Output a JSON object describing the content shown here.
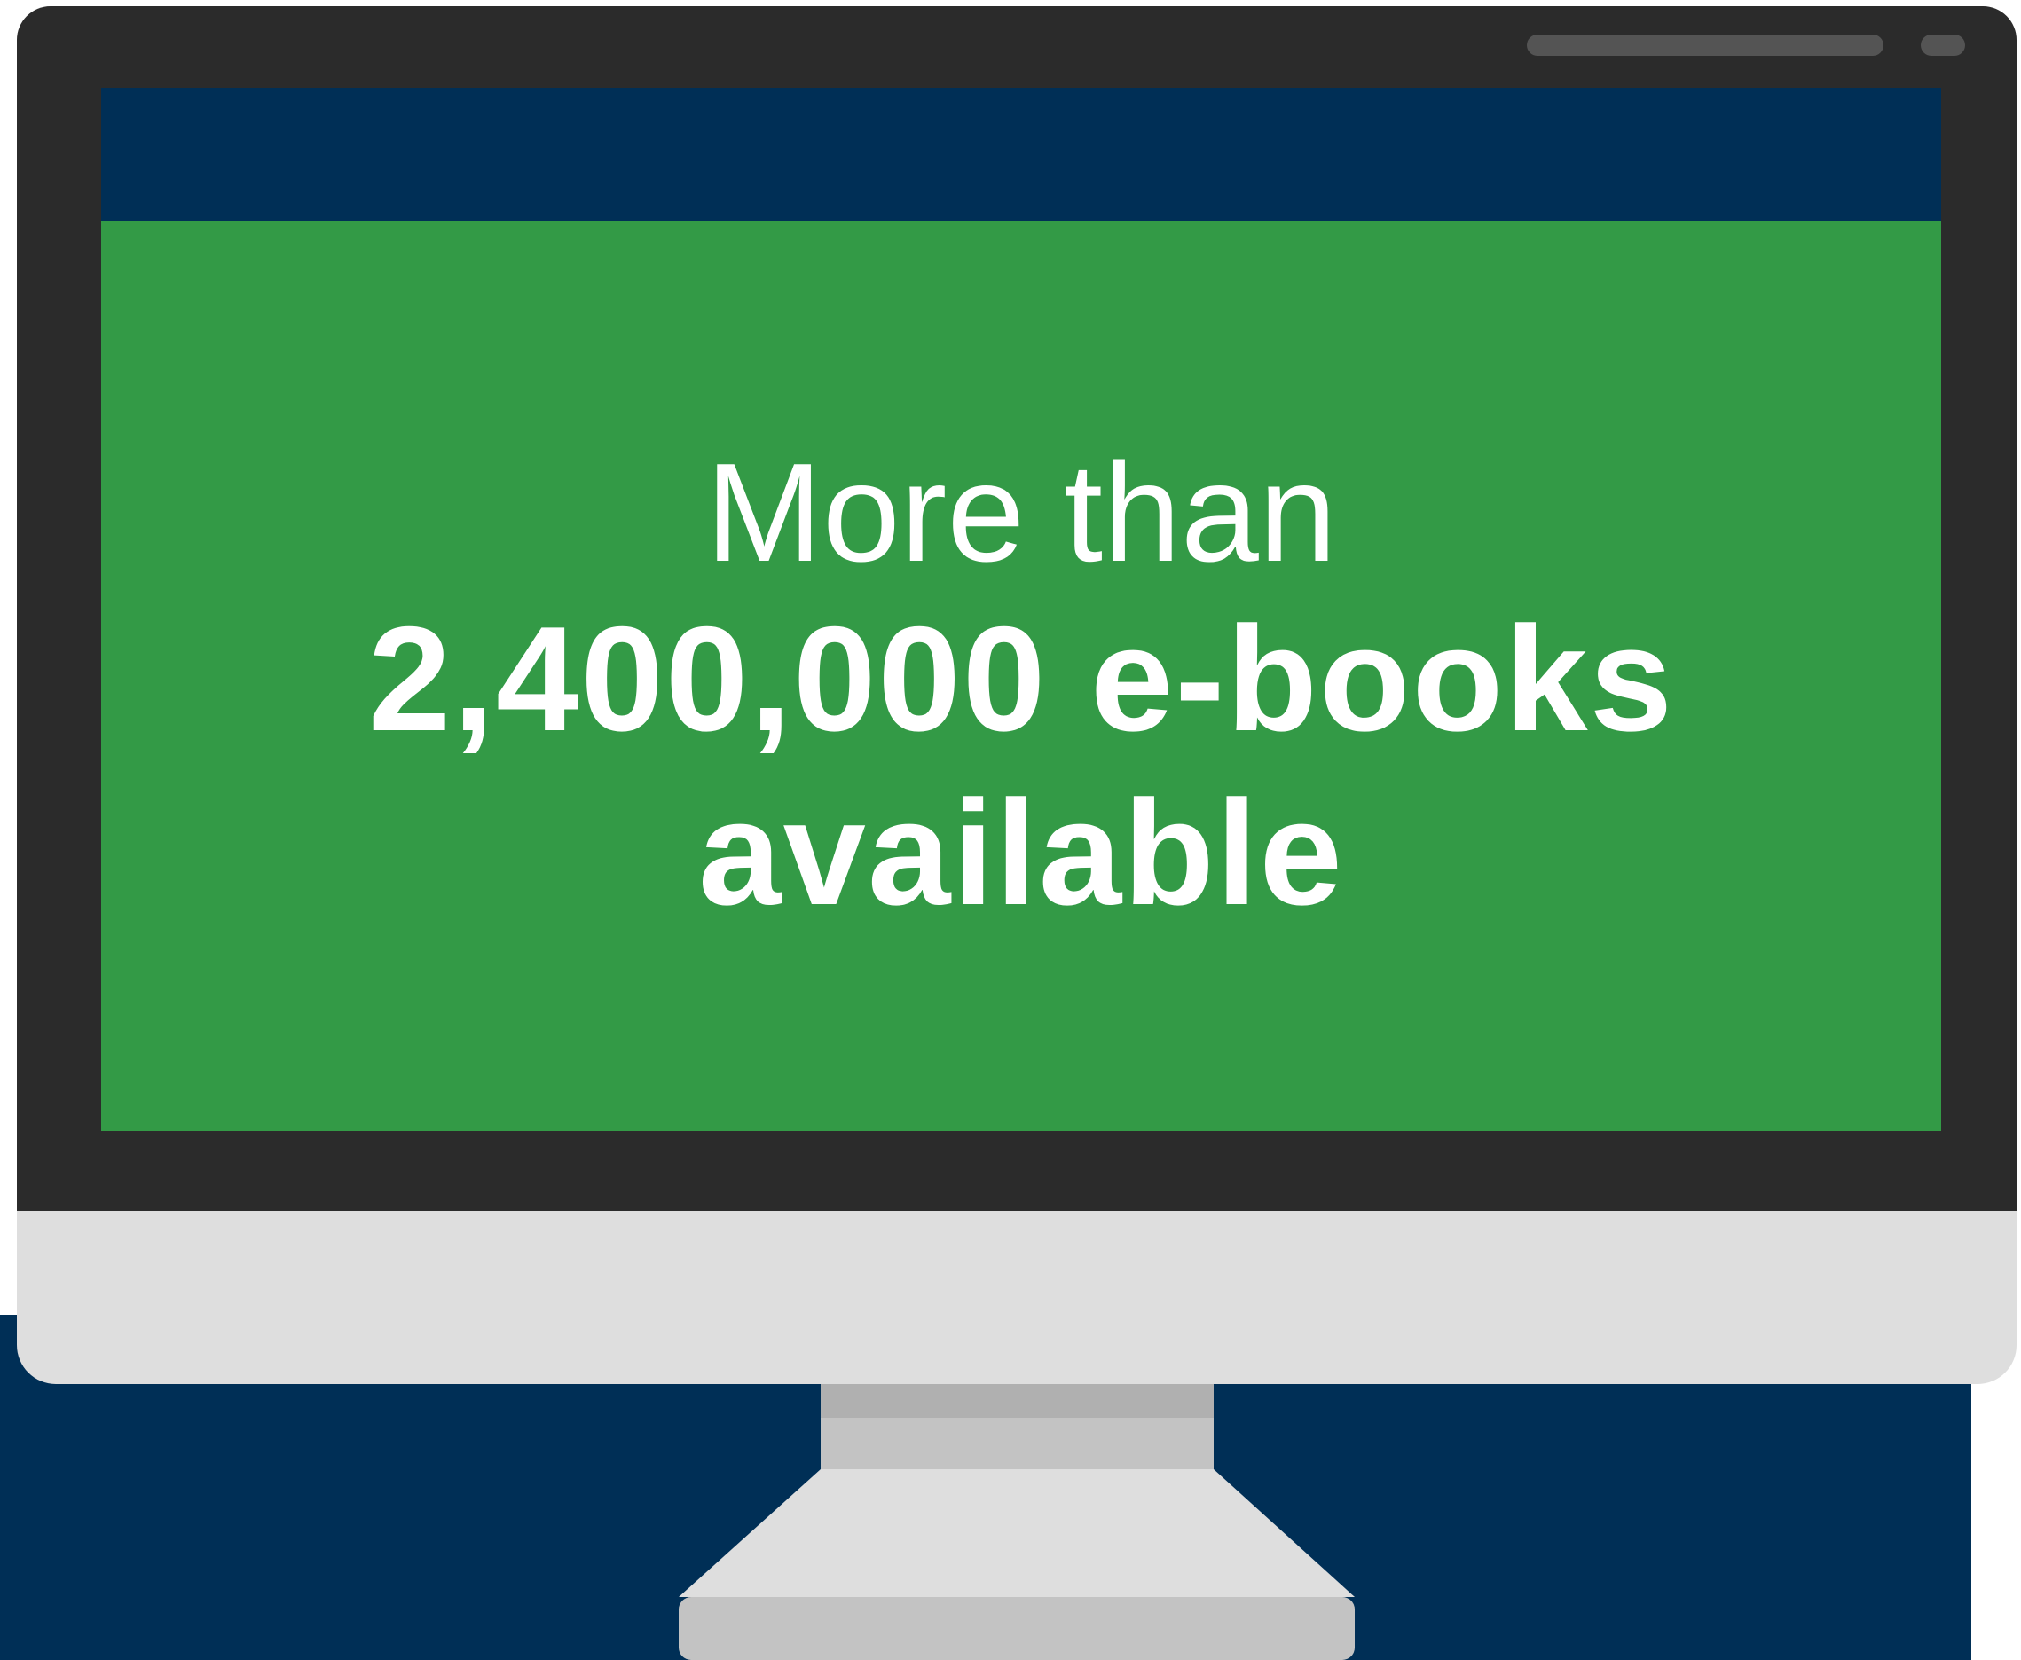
{
  "screen": {
    "headline_line1": "More than",
    "headline_line2": "2,400,000 e-books available"
  },
  "colors": {
    "navy": "#002f56",
    "green": "#339a46",
    "bezel": "#2b2b2b",
    "chin": "#dedede",
    "text": "#ffffff"
  }
}
